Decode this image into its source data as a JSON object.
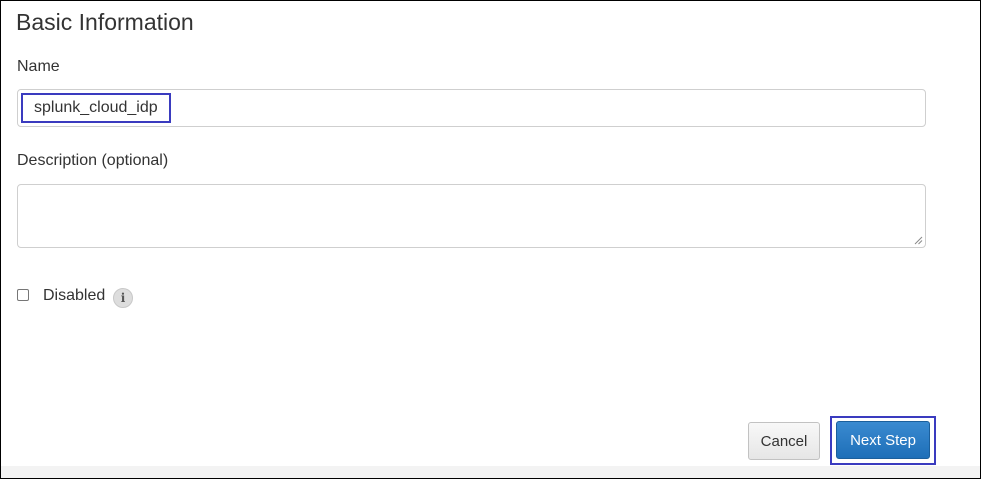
{
  "section": {
    "title": "Basic Information"
  },
  "form": {
    "name_label": "Name",
    "name_value": "splunk_cloud_idp",
    "description_label": "Description (optional)",
    "description_value": "",
    "disabled_label": "Disabled",
    "disabled_checked": false,
    "info_icon": "info-icon",
    "info_glyph": "i"
  },
  "actions": {
    "cancel_label": "Cancel",
    "next_label": "Next Step"
  },
  "colors": {
    "highlight_box": "#3a3bbf",
    "primary_button": "#2b7bc4",
    "text": "#333333"
  }
}
